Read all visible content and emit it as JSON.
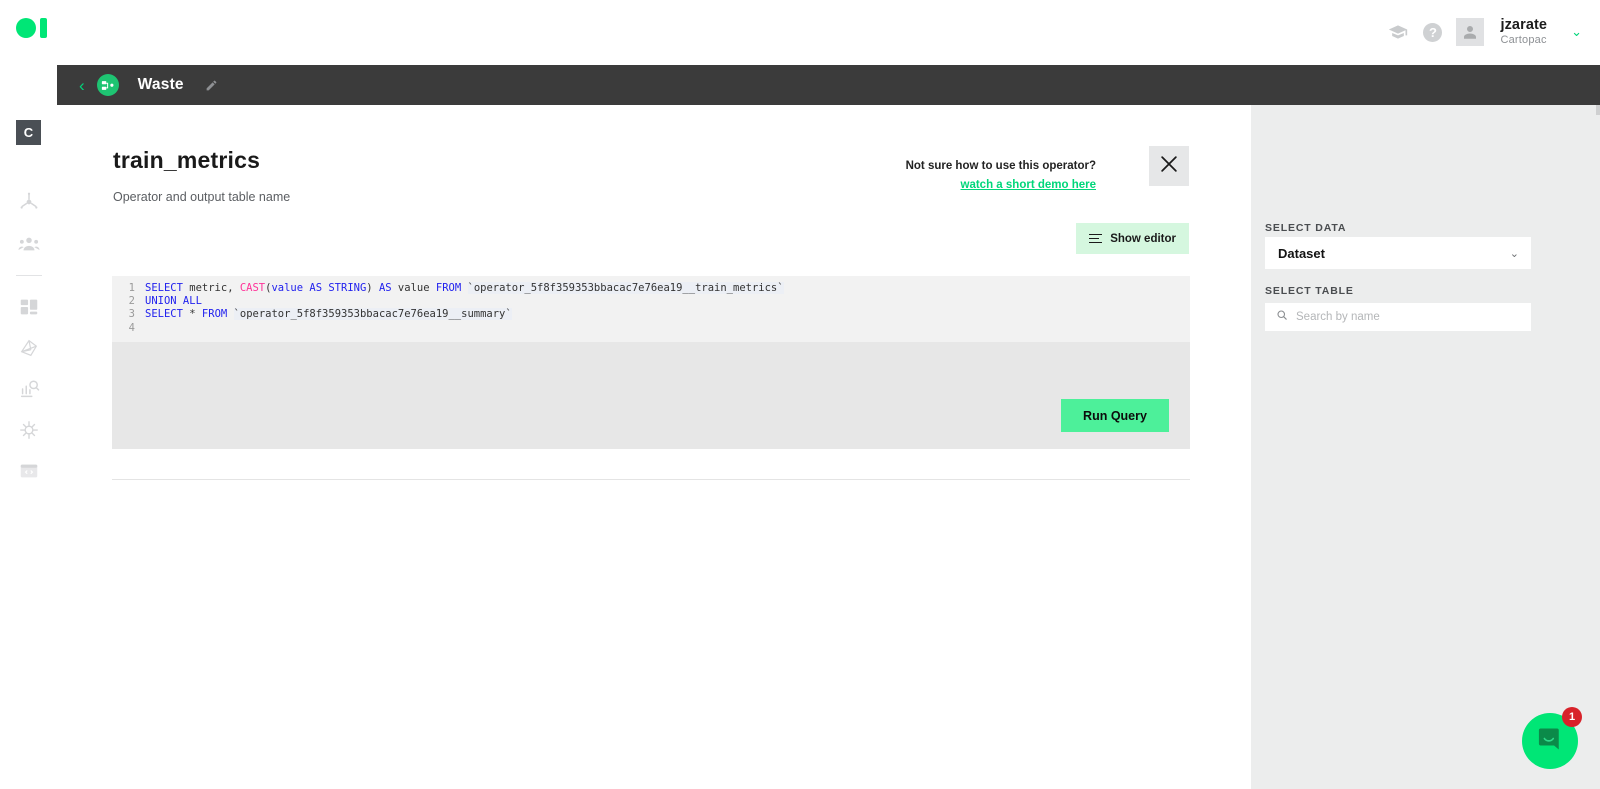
{
  "topbar": {
    "logo_name": "octopus-logo",
    "accent": "#00e676",
    "graduation_icon": "graduation-cap-icon",
    "help_icon": "help-circle-icon",
    "help_glyph": "?",
    "avatar_icon": "user-avatar-icon",
    "user_name": "jzarate",
    "user_org": "Cartopac",
    "chevron": "⌄"
  },
  "projectbar": {
    "back_glyph": "‹",
    "project_icon": "pipeline-icon",
    "title": "Waste",
    "edit_icon": "pencil-icon"
  },
  "rail": {
    "badge": "C",
    "items": [
      {
        "name": "sidebar-item-operators",
        "icon": "network-node-icon"
      },
      {
        "name": "sidebar-item-teams",
        "icon": "people-group-icon"
      },
      {
        "name": "sidebar-item-dashboards",
        "icon": "dashboard-grid-icon"
      },
      {
        "name": "sidebar-item-graph",
        "icon": "graph-mesh-icon"
      },
      {
        "name": "sidebar-item-analytics",
        "icon": "bar-chart-search-icon"
      },
      {
        "name": "sidebar-item-models",
        "icon": "brain-icon"
      },
      {
        "name": "sidebar-item-code",
        "icon": "code-window-icon"
      }
    ]
  },
  "main": {
    "title": "train_metrics",
    "subtitle": "Operator and output table name",
    "helper_text": "Not sure how to use this operator?",
    "helper_link": "watch a short demo here",
    "close_icon": "close-icon",
    "show_editor_label": "Show editor",
    "show_editor_icon": "lines-icon",
    "run_query_label": "Run Query",
    "editor": {
      "lines": [
        {
          "number": "1",
          "tokens": [
            {
              "t": "SELECT",
              "c": "kw"
            },
            {
              "t": " metric, ",
              "c": "plain"
            },
            {
              "t": "CAST",
              "c": "fn"
            },
            {
              "t": "(",
              "c": "plain"
            },
            {
              "t": "value AS STRING",
              "c": "kw"
            },
            {
              "t": ") ",
              "c": "plain"
            },
            {
              "t": "AS",
              "c": "kw"
            },
            {
              "t": " value ",
              "c": "plain"
            },
            {
              "t": "FROM",
              "c": "kw"
            },
            {
              "t": " ",
              "c": "plain"
            },
            {
              "t": "`operator_5f8f359353bbacac7e76ea19__train_metrics`",
              "c": "str"
            }
          ]
        },
        {
          "number": "2",
          "tokens": [
            {
              "t": "UNION ALL",
              "c": "kw"
            }
          ]
        },
        {
          "number": "3",
          "tokens": [
            {
              "t": "SELECT",
              "c": "kw"
            },
            {
              "t": " ",
              "c": "plain"
            },
            {
              "t": "*",
              "c": "plain"
            },
            {
              "t": " ",
              "c": "plain"
            },
            {
              "t": "FROM",
              "c": "kw"
            },
            {
              "t": " ",
              "c": "plain"
            },
            {
              "t": "`operator_5f8f359353bbacac7e76ea19__summary`",
              "c": "str"
            }
          ]
        },
        {
          "number": "4",
          "tokens": []
        }
      ]
    }
  },
  "rightpanel": {
    "select_data_label": "SELECT DATA",
    "select_data_value": "Dataset",
    "select_data_chevron": "⌄",
    "select_table_label": "SELECT TABLE",
    "search_placeholder": "Search by name",
    "search_value": "",
    "search_icon": "search-icon"
  },
  "intercom": {
    "icon": "chat-bubble-icon",
    "badge_count": "1",
    "bubble_color": "#00e676",
    "badge_color": "#d8222a"
  }
}
